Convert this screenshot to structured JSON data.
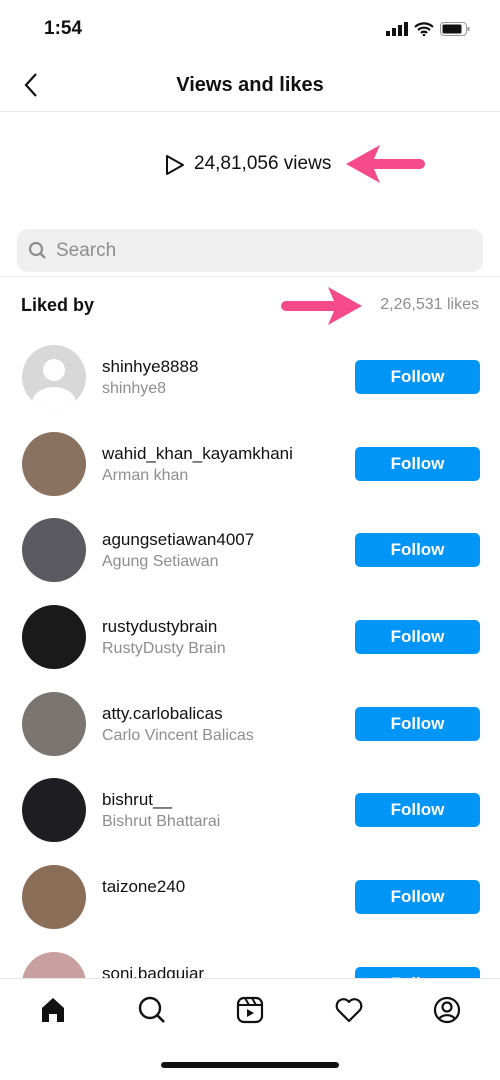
{
  "status": {
    "time": "1:54"
  },
  "header": {
    "title": "Views and likes"
  },
  "views": {
    "text": "24,81,056 views"
  },
  "search": {
    "placeholder": "Search"
  },
  "liked": {
    "label": "Liked by",
    "count": "2,26,531 likes"
  },
  "accent": "#0095f6",
  "annotation_color": "#f54b8a",
  "users": [
    {
      "username": "shinhye8888",
      "name": "shinhye8",
      "follow": "Follow",
      "avatar": "#d8d8d8"
    },
    {
      "username": "wahid_khan_kayamkhani",
      "name": "Arman khan",
      "follow": "Follow",
      "avatar": "#8a7260"
    },
    {
      "username": "agungsetiawan4007",
      "name": "Agung Setiawan",
      "follow": "Follow",
      "avatar": "#5a5a60"
    },
    {
      "username": "rustydustybrain",
      "name": "RustyDusty Brain",
      "follow": "Follow",
      "avatar": "#1a1a1a"
    },
    {
      "username": "atty.carlobalicas",
      "name": "Carlo Vincent Balicas",
      "follow": "Follow",
      "avatar": "#7a7570"
    },
    {
      "username": "bishrut__",
      "name": "Bishrut Bhattarai",
      "follow": "Follow",
      "avatar": "#1e1e22"
    },
    {
      "username": "taizone240",
      "name": "",
      "follow": "Follow",
      "avatar": "#8a6e58"
    },
    {
      "username": "soni.badgujar",
      "name": "",
      "follow": "Follow",
      "avatar": "#c9a0a0"
    }
  ],
  "nav": [
    "home-icon",
    "search-icon",
    "reels-icon",
    "heart-icon",
    "profile-icon"
  ]
}
